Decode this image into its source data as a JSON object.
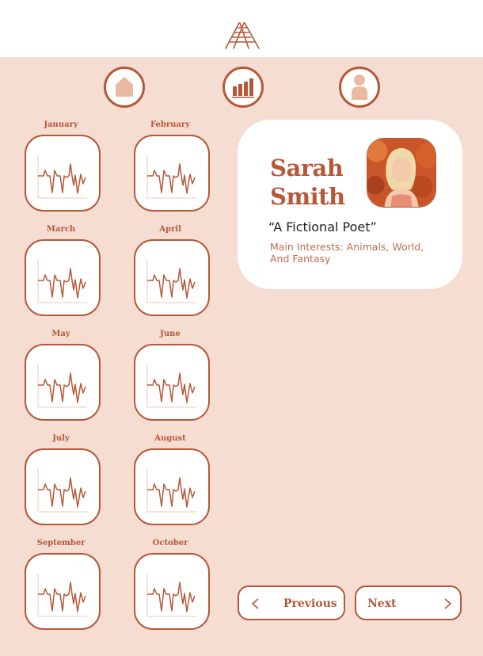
{
  "header": {
    "logo_icon": "ladder-logo-icon"
  },
  "nav": {
    "items": [
      {
        "name": "home",
        "icon": "home-icon"
      },
      {
        "name": "stats",
        "icon": "bar-chart-icon"
      },
      {
        "name": "profile",
        "icon": "user-icon"
      }
    ]
  },
  "months": {
    "items": [
      "January",
      "February",
      "March",
      "April",
      "May",
      "June",
      "July",
      "August",
      "September",
      "October"
    ],
    "tile_icon": "heartbeat-chart-icon"
  },
  "profile": {
    "first_name": "Sarah",
    "last_name": "Smith",
    "tagline": "“A Fictional Poet”",
    "interests": "Main Interests: Animals, World, And Fantasy"
  },
  "pagination": {
    "previous_label": "Previous",
    "next_label": "Next"
  },
  "colors": {
    "accent": "#b65838",
    "panel_bg": "#f5ddd2",
    "card_bg": "#ffffff",
    "icon_fill": "#e9b9a2"
  }
}
